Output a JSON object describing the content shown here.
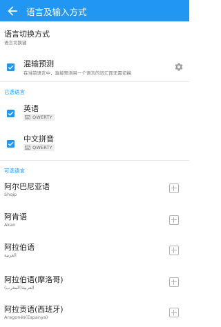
{
  "appbar": {
    "title": "语言及输入方式"
  },
  "switch_mode": {
    "title": "语言切换方式",
    "subtitle": "语言切换键"
  },
  "mixed_prediction": {
    "title": "混输预测",
    "subtitle": "在当前语言中，直接预测另一个语言的词汇而无需切换",
    "checked": true
  },
  "selected_section": {
    "label": "已选语言"
  },
  "selected_languages": [
    {
      "name": "英语",
      "layout": "QWERTY",
      "checked": true
    },
    {
      "name": "中文拼音",
      "layout": "QWERTY",
      "checked": true
    }
  ],
  "available_section": {
    "label": "可选语言"
  },
  "available_languages": [
    {
      "name": "阿尔巴尼亚语",
      "native": "Shqip"
    },
    {
      "name": "阿肯语",
      "native": "Akan"
    },
    {
      "name": "阿拉伯语",
      "native": "العربية"
    },
    {
      "name": "阿拉伯语(摩洛哥)",
      "native": "العربية(المغرب)"
    },
    {
      "name": "阿拉贡语(西班牙)",
      "native": "Aragonés(Espanya)"
    }
  ],
  "colors": {
    "accent": "#2196f3",
    "divider": "#e6e6e6",
    "secondary_text": "#757575"
  },
  "icons": {
    "back": "arrow-left-icon",
    "settings": "gear-icon",
    "keyboard": "keyboard-icon",
    "add": "plus-square-icon"
  }
}
